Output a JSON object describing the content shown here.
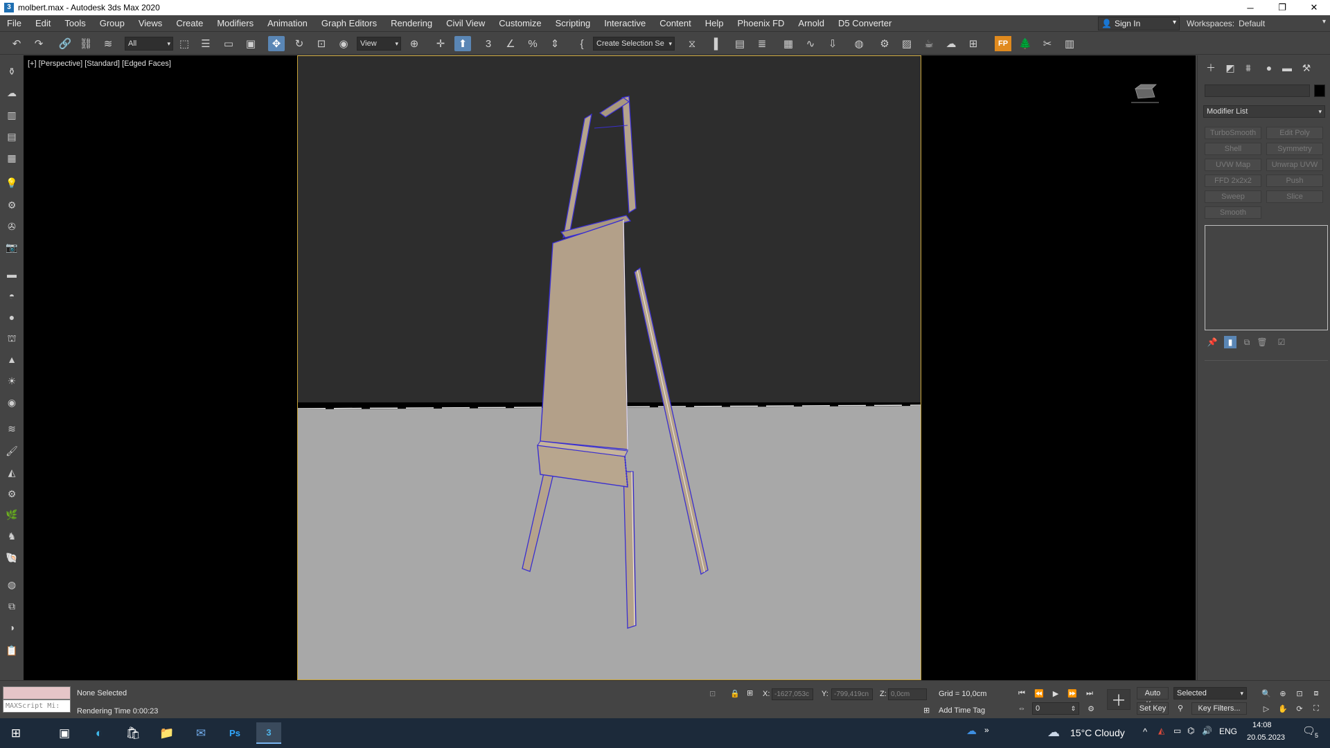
{
  "window": {
    "app_icon": "3",
    "title": "molbert.max - Autodesk 3ds Max 2020",
    "minimize": "─",
    "maximize": "❐",
    "close": "✕"
  },
  "menu": [
    "File",
    "Edit",
    "Tools",
    "Group",
    "Views",
    "Create",
    "Modifiers",
    "Animation",
    "Graph Editors",
    "Rendering",
    "Civil View",
    "Customize",
    "Scripting",
    "Interactive",
    "Content",
    "Help",
    "Phoenix FD",
    "Arnold",
    "D5 Converter"
  ],
  "signin": {
    "label": "Sign In",
    "icon": "user-icon"
  },
  "workspaces": {
    "label": "Workspaces:",
    "value": "Default"
  },
  "toolbar": {
    "selection_filter": "All",
    "ref_coord": "View",
    "named_selection": "Create Selection Se"
  },
  "viewport": {
    "label": "[+] [Perspective] [Standard] [Edged Faces]",
    "sky_color": "#2d2d2d",
    "ground_color": "#a8a8a8",
    "wood_color": "#b5a38c",
    "wire_color": "#3a2fd0",
    "frame_color": "#c9a53a"
  },
  "command_panel": {
    "modifier_list": "Modifier List",
    "modifier_buttons": [
      "TurboSmooth",
      "Edit Poly",
      "Shell",
      "Symmetry",
      "UVW Map",
      "Unwrap UVW",
      "FFD 2x2x2",
      "Push",
      "Sweep",
      "Slice",
      "Smooth"
    ]
  },
  "status": {
    "selection": "None Selected",
    "render_time": "Rendering Time  0:00:23",
    "maxscript_placeholder": "MAXScript Mi:",
    "x_label": "X:",
    "x_value": "-1627,053c",
    "y_label": "Y:",
    "y_value": "-799,419cn",
    "z_label": "Z:",
    "z_value": "0,0cm",
    "grid": "Grid = 10,0cm",
    "add_time_tag": "Add Time Tag",
    "auto_key": "Auto Key",
    "set_key": "Set Key",
    "key_mode": "Selected",
    "key_filters": "Key Filters...",
    "frame": "0"
  },
  "taskbar": {
    "weather": "15°C  Cloudy",
    "lang": "ENG",
    "time": "14:08",
    "date": "20.05.2023",
    "notifications": "5",
    "overflow": "»",
    "up_arrow": "^",
    "ps_label": "Ps",
    "max_label": "3"
  }
}
